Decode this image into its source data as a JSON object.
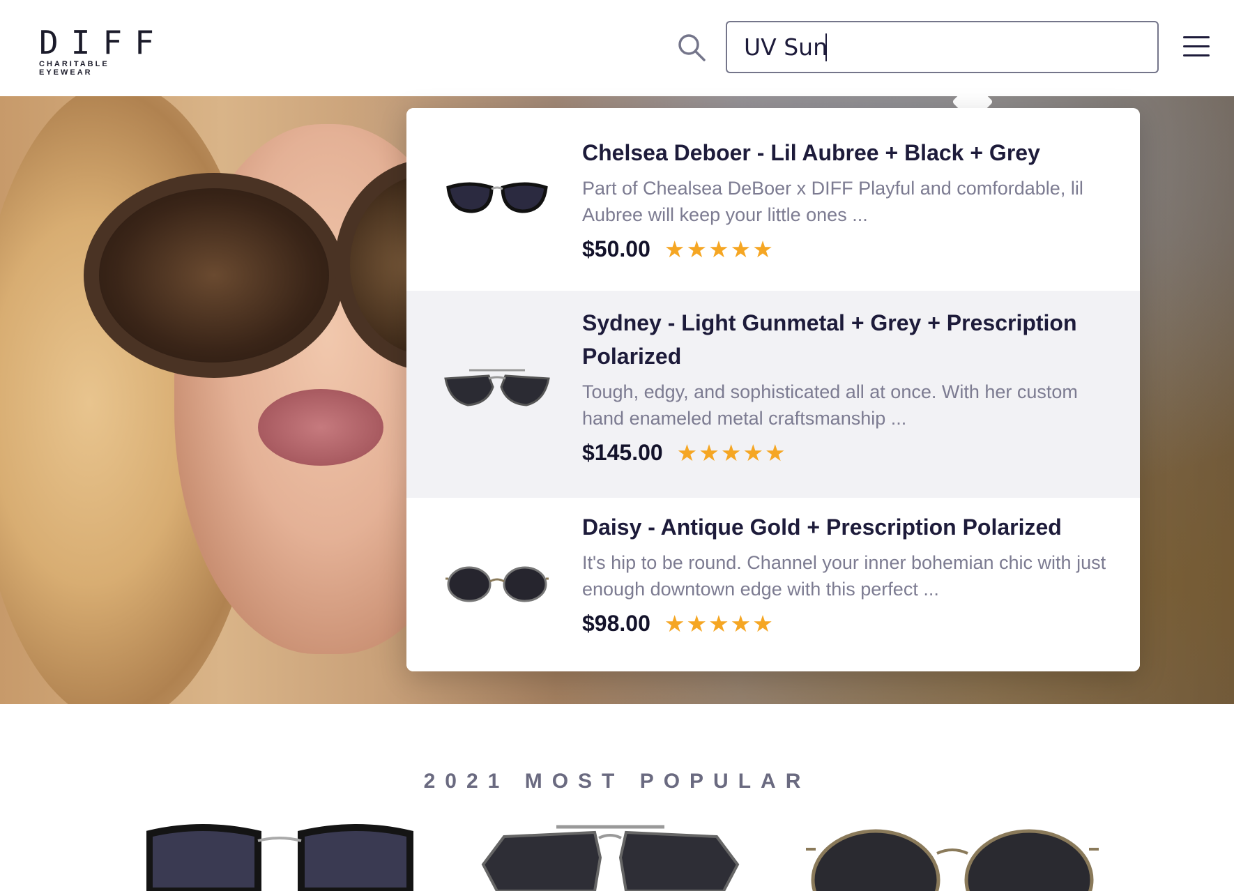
{
  "header": {
    "logo_main": "DIFF",
    "logo_sub": "CHARITABLE EYEWEAR",
    "search_value": "UV Sun",
    "icons": [
      "search-icon",
      "hamburger-menu-icon"
    ]
  },
  "results": [
    {
      "title": "Chelsea Deboer - Lil Aubree + Black + Grey",
      "description": "Part of Chealsea DeBoer x DIFF Playful and comfordable, lil Aubree will keep your little ones ...",
      "price": "$50.00",
      "rating": 5
    },
    {
      "title": "Sydney - Light Gunmetal + Grey + Prescription Polarized",
      "description": "Tough, edgy, and sophisticated all at once. With her custom hand enameled metal craftsmanship ...",
      "price": "$145.00",
      "rating": 5
    },
    {
      "title": "Daisy - Antique Gold + Prescription Polarized",
      "description": "It's hip to be round. Channel your inner bohemian chic with just enough downtown edge with this perfect ...",
      "price": "$98.00",
      "rating": 5
    }
  ],
  "section": {
    "title": "2021 MOST POPULAR"
  },
  "colors": {
    "text_dark": "#1d1b3a",
    "text_muted": "#7c7b91",
    "star": "#f5a623",
    "highlight_row": "#f2f2f5"
  }
}
